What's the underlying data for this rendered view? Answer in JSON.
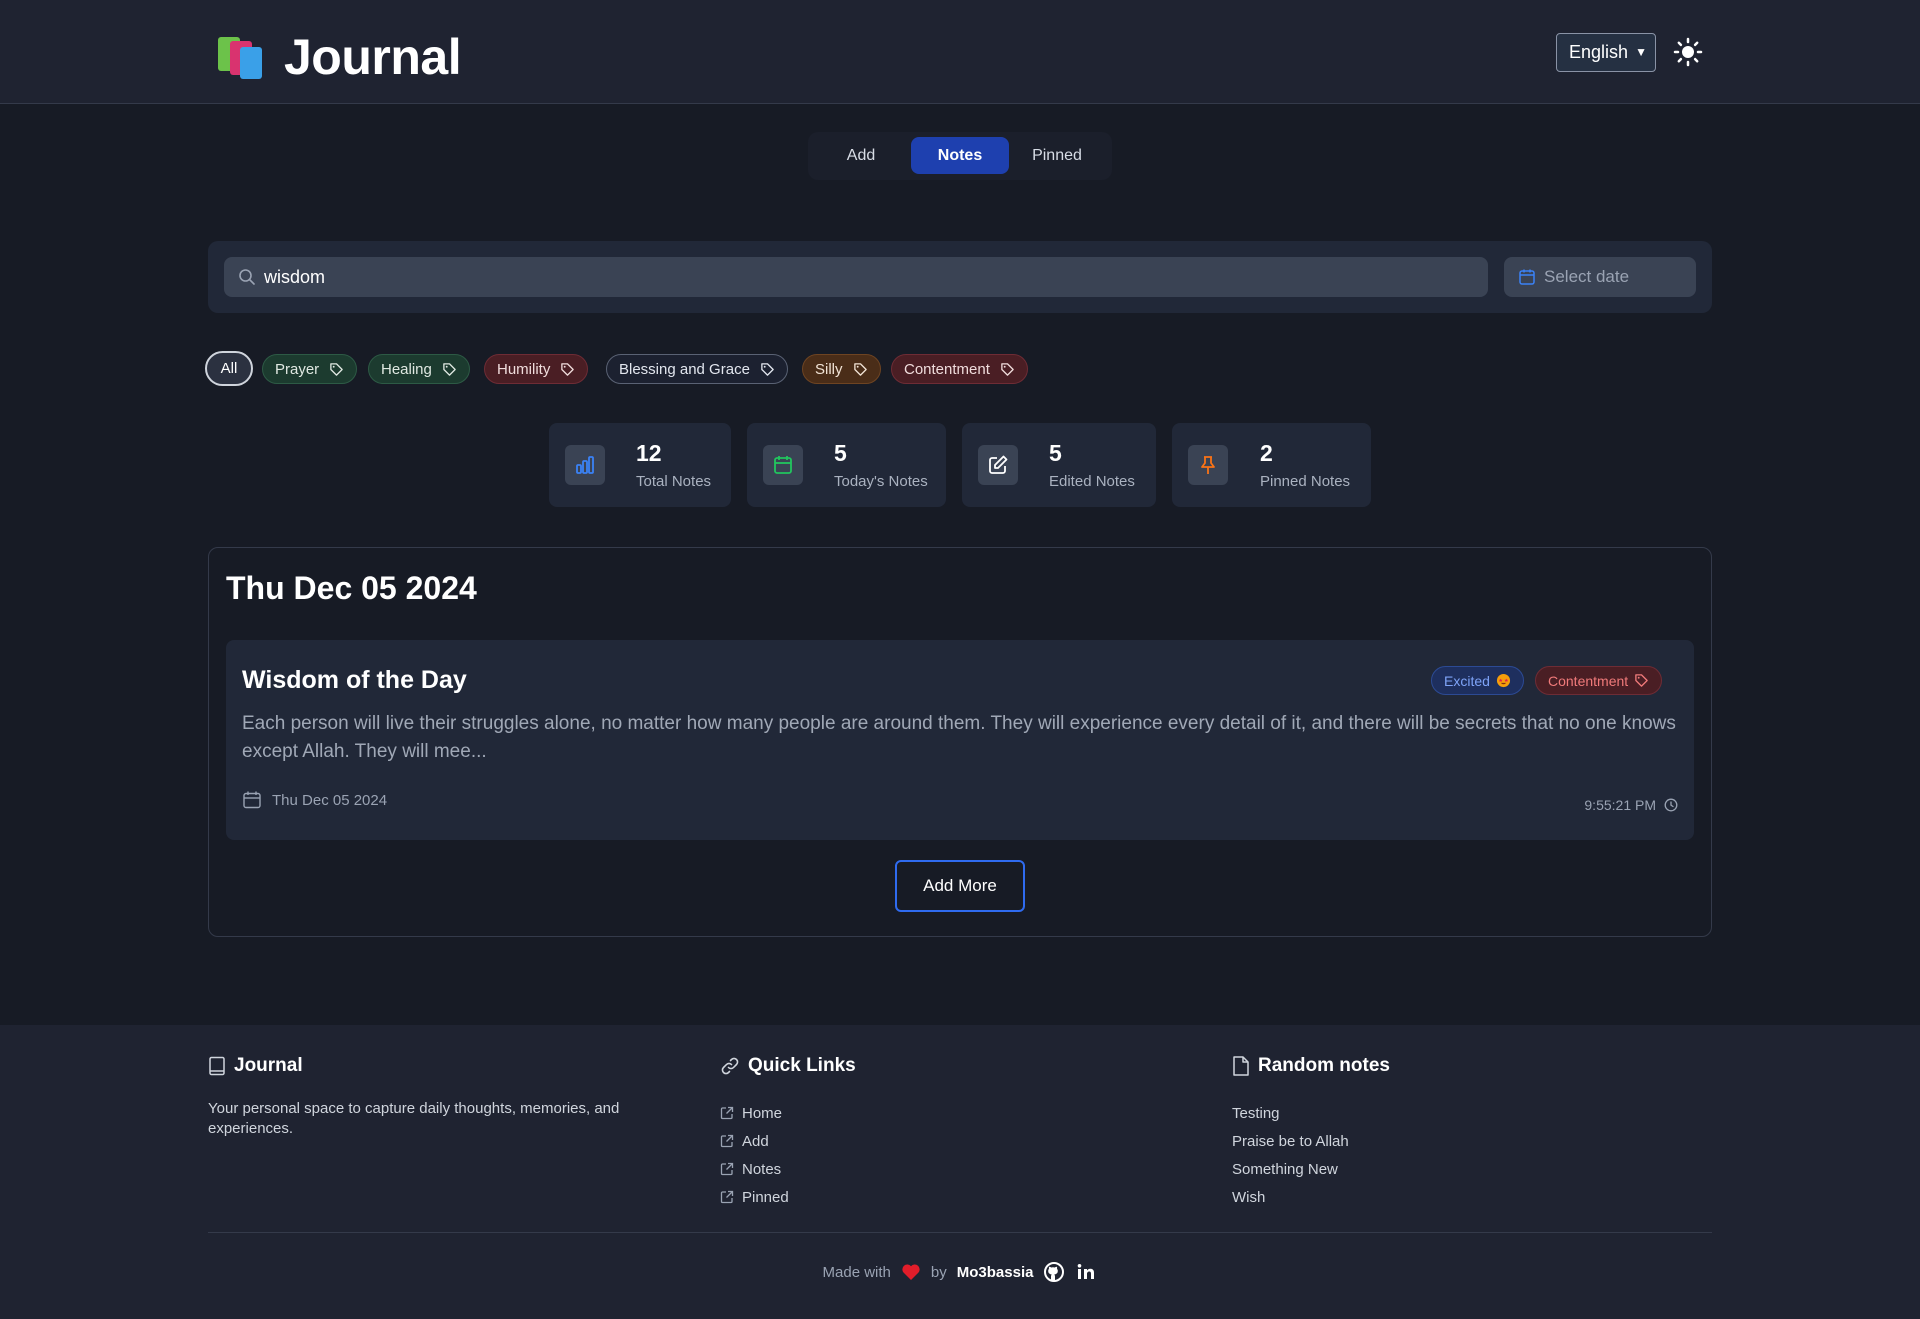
{
  "header": {
    "title": "Journal",
    "language": "English"
  },
  "tabs": [
    {
      "label": "Add"
    },
    {
      "label": "Notes"
    },
    {
      "label": "Pinned"
    }
  ],
  "search": {
    "value": "wisdom",
    "date_placeholder": "Select date"
  },
  "tag_filters": {
    "all": "All",
    "items": [
      "Prayer",
      "Healing",
      "Humility",
      "Blessing and Grace",
      "Silly",
      "Contentment"
    ]
  },
  "stats": [
    {
      "value": "12",
      "label": "Total Notes"
    },
    {
      "value": "5",
      "label": "Today's Notes"
    },
    {
      "value": "5",
      "label": "Edited Notes"
    },
    {
      "value": "2",
      "label": "Pinned Notes"
    }
  ],
  "day_group": {
    "date": "Thu Dec 05 2024",
    "note": {
      "title": "Wisdom of the Day",
      "mood": "Excited",
      "tag": "Contentment",
      "body": "Each person will live their struggles alone, no matter how many people are around them. They will experience every detail of it, and there will be secrets that no one knows except Allah. They will mee...",
      "date": "Thu Dec 05 2024",
      "time": "9:55:21 PM"
    },
    "add_more": "Add More"
  },
  "footer": {
    "about": {
      "title": "Journal",
      "text": "Your personal space to capture daily thoughts, memories, and experiences."
    },
    "quick_links": {
      "title": "Quick Links",
      "items": [
        "Home",
        "Add",
        "Notes",
        "Pinned"
      ]
    },
    "random_notes": {
      "title": "Random notes",
      "items": [
        "Testing",
        "Praise be to Allah",
        "Something New",
        "Wish"
      ]
    },
    "made_with": "Made with",
    "by": "by",
    "author": "Mo3bassia"
  },
  "colors": {
    "background": "#171b25",
    "surface": "#212838",
    "accent": "#1e40af",
    "accent_border": "#2f6bf0"
  }
}
